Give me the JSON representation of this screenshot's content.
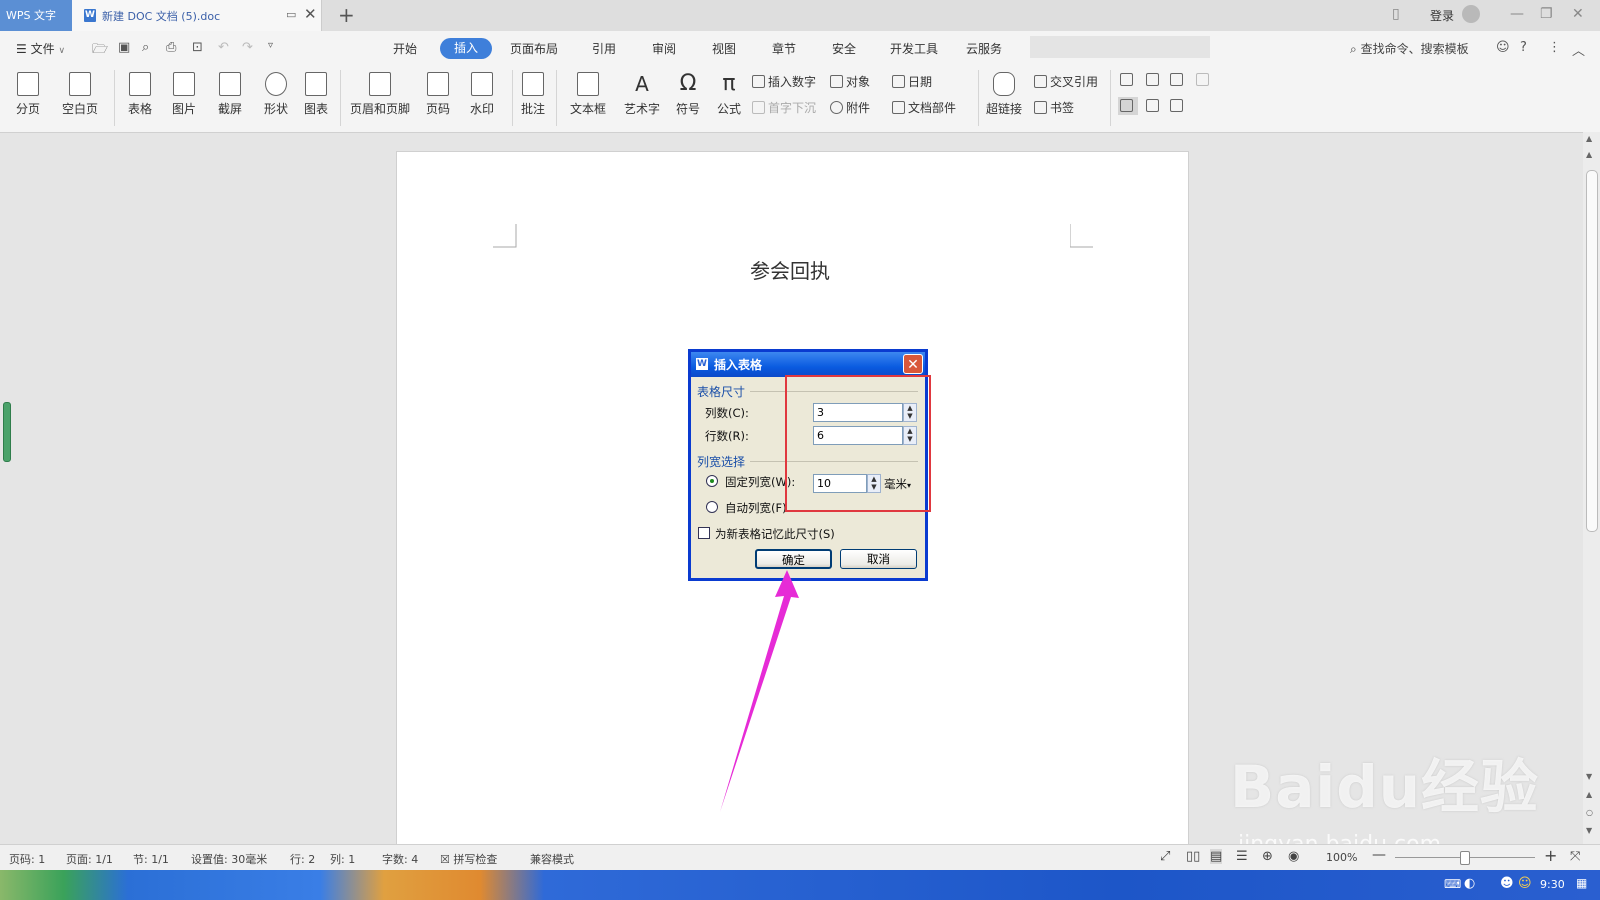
{
  "titlebar": {
    "app_tab": "WPS 文字",
    "doc_tab": "新建 DOC 文档 (5).doc",
    "login": "登录"
  },
  "menubar": {
    "file": "文件",
    "tabs": [
      "开始",
      "插入",
      "页面布局",
      "引用",
      "审阅",
      "视图",
      "章节",
      "安全",
      "开发工具",
      "云服务"
    ],
    "active_tab": "插入",
    "search": "查找命令、搜索模板"
  },
  "ribbon": {
    "big": [
      "分页",
      "空白页",
      "表格",
      "图片",
      "截屏",
      "形状",
      "图表",
      "页眉和页脚",
      "页码",
      "水印",
      "批注",
      "文本框",
      "艺术字",
      "符号",
      "公式"
    ],
    "small": [
      "插入数字",
      "首字下沉",
      "对象",
      "附件",
      "日期",
      "文档部件",
      "交叉引用",
      "书签"
    ],
    "hyperlink": "超链接"
  },
  "document": {
    "heading": "参会回执"
  },
  "dialog": {
    "title": "插入表格",
    "size_group": "表格尺寸",
    "cols_label": "列数(C):",
    "cols_value": "3",
    "rows_label": "行数(R):",
    "rows_value": "6",
    "width_group": "列宽选择",
    "fixed_label": "固定列宽(W):",
    "fixed_value": "10",
    "unit": "毫米",
    "auto_label": "自动列宽(F)",
    "remember_label": "为新表格记忆此尺寸(S)",
    "ok": "确定",
    "cancel": "取消",
    "fixed_selected": true,
    "remember_checked": false
  },
  "statusbar": {
    "page_no": "页码: 1",
    "pages": "页面: 1/1",
    "section": "节: 1/1",
    "setting": "设置值: 30毫米",
    "row": "行: 2",
    "col": "列: 1",
    "words": "字数: 4",
    "spell": "拼写检查",
    "compat": "兼容模式",
    "zoom": "100%"
  },
  "taskbar": {
    "clock": "9:30"
  },
  "watermark": {
    "brand": "Baidu经验",
    "url": "jingyan.baidu.com"
  },
  "colors": {
    "accent": "#3e7fda",
    "dialog_border": "#0a3bd0",
    "highlight": "#e0383f",
    "arrow": "#e62bd6"
  }
}
